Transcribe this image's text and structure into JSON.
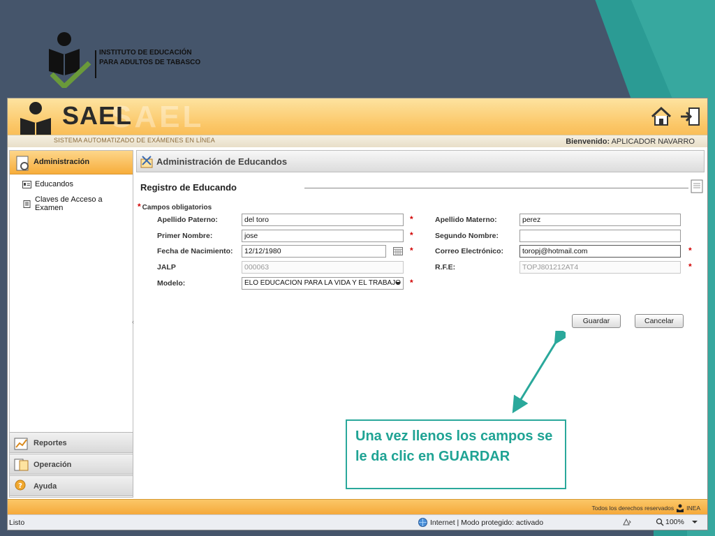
{
  "slide": {
    "institute_name": "INSTITUTO DE EDUCACIÓN PARA ADULTOS DE TABASCO",
    "callout_text": "Una vez llenos los campos se le da clic en GUARDAR",
    "accent_color": "#2aa89b"
  },
  "app": {
    "title": "SAEL",
    "subtitle": "SISTEMA AUTOMATIZADO DE EXÁMENES EN LÍNEA",
    "welcome_label": "Bienvenido:",
    "welcome_user": "APLICADOR NAVARRO",
    "header_icons": [
      "home-icon",
      "logout-icon"
    ]
  },
  "sidebar": {
    "active_section": "Administración",
    "items": [
      "Educandos",
      "Claves de Acceso a Examen"
    ],
    "bottom_sections": [
      "Reportes",
      "Operación",
      "Ayuda"
    ]
  },
  "main": {
    "panel_title": "Administración de Educandos",
    "section_title": "Registro de Educando",
    "required_note": "Campos obligatorios",
    "fields": {
      "apellido_paterno": {
        "label": "Apellido Paterno:",
        "value": "del toro"
      },
      "apellido_materno": {
        "label": "Apellido Materno:",
        "value": "perez"
      },
      "primer_nombre": {
        "label": "Primer Nombre:",
        "value": "jose"
      },
      "segundo_nombre": {
        "label": "Segundo Nombre:",
        "value": ""
      },
      "fecha_nacimiento": {
        "label": "Fecha de Nacimiento:",
        "value": "12/12/1980"
      },
      "correo": {
        "label": "Correo Electrónico:",
        "value": "toropj@hotmail.com"
      },
      "jalp": {
        "label": "JALP",
        "value": "000063"
      },
      "rfe": {
        "label": "R.F.E:",
        "value": "TOPJ801212AT4"
      },
      "modelo": {
        "label": "Modelo:",
        "value": "ELO EDUCACION PARA LA VIDA Y EL TRABAJO"
      }
    },
    "buttons": {
      "save": "Guardar",
      "cancel": "Cancelar"
    }
  },
  "footer": {
    "rights": "Todos los derechos reservados",
    "brand": "INEA"
  },
  "statusbar": {
    "left": "Listo",
    "zone": "Internet | Modo protegido: activado",
    "zoom": "100%"
  }
}
